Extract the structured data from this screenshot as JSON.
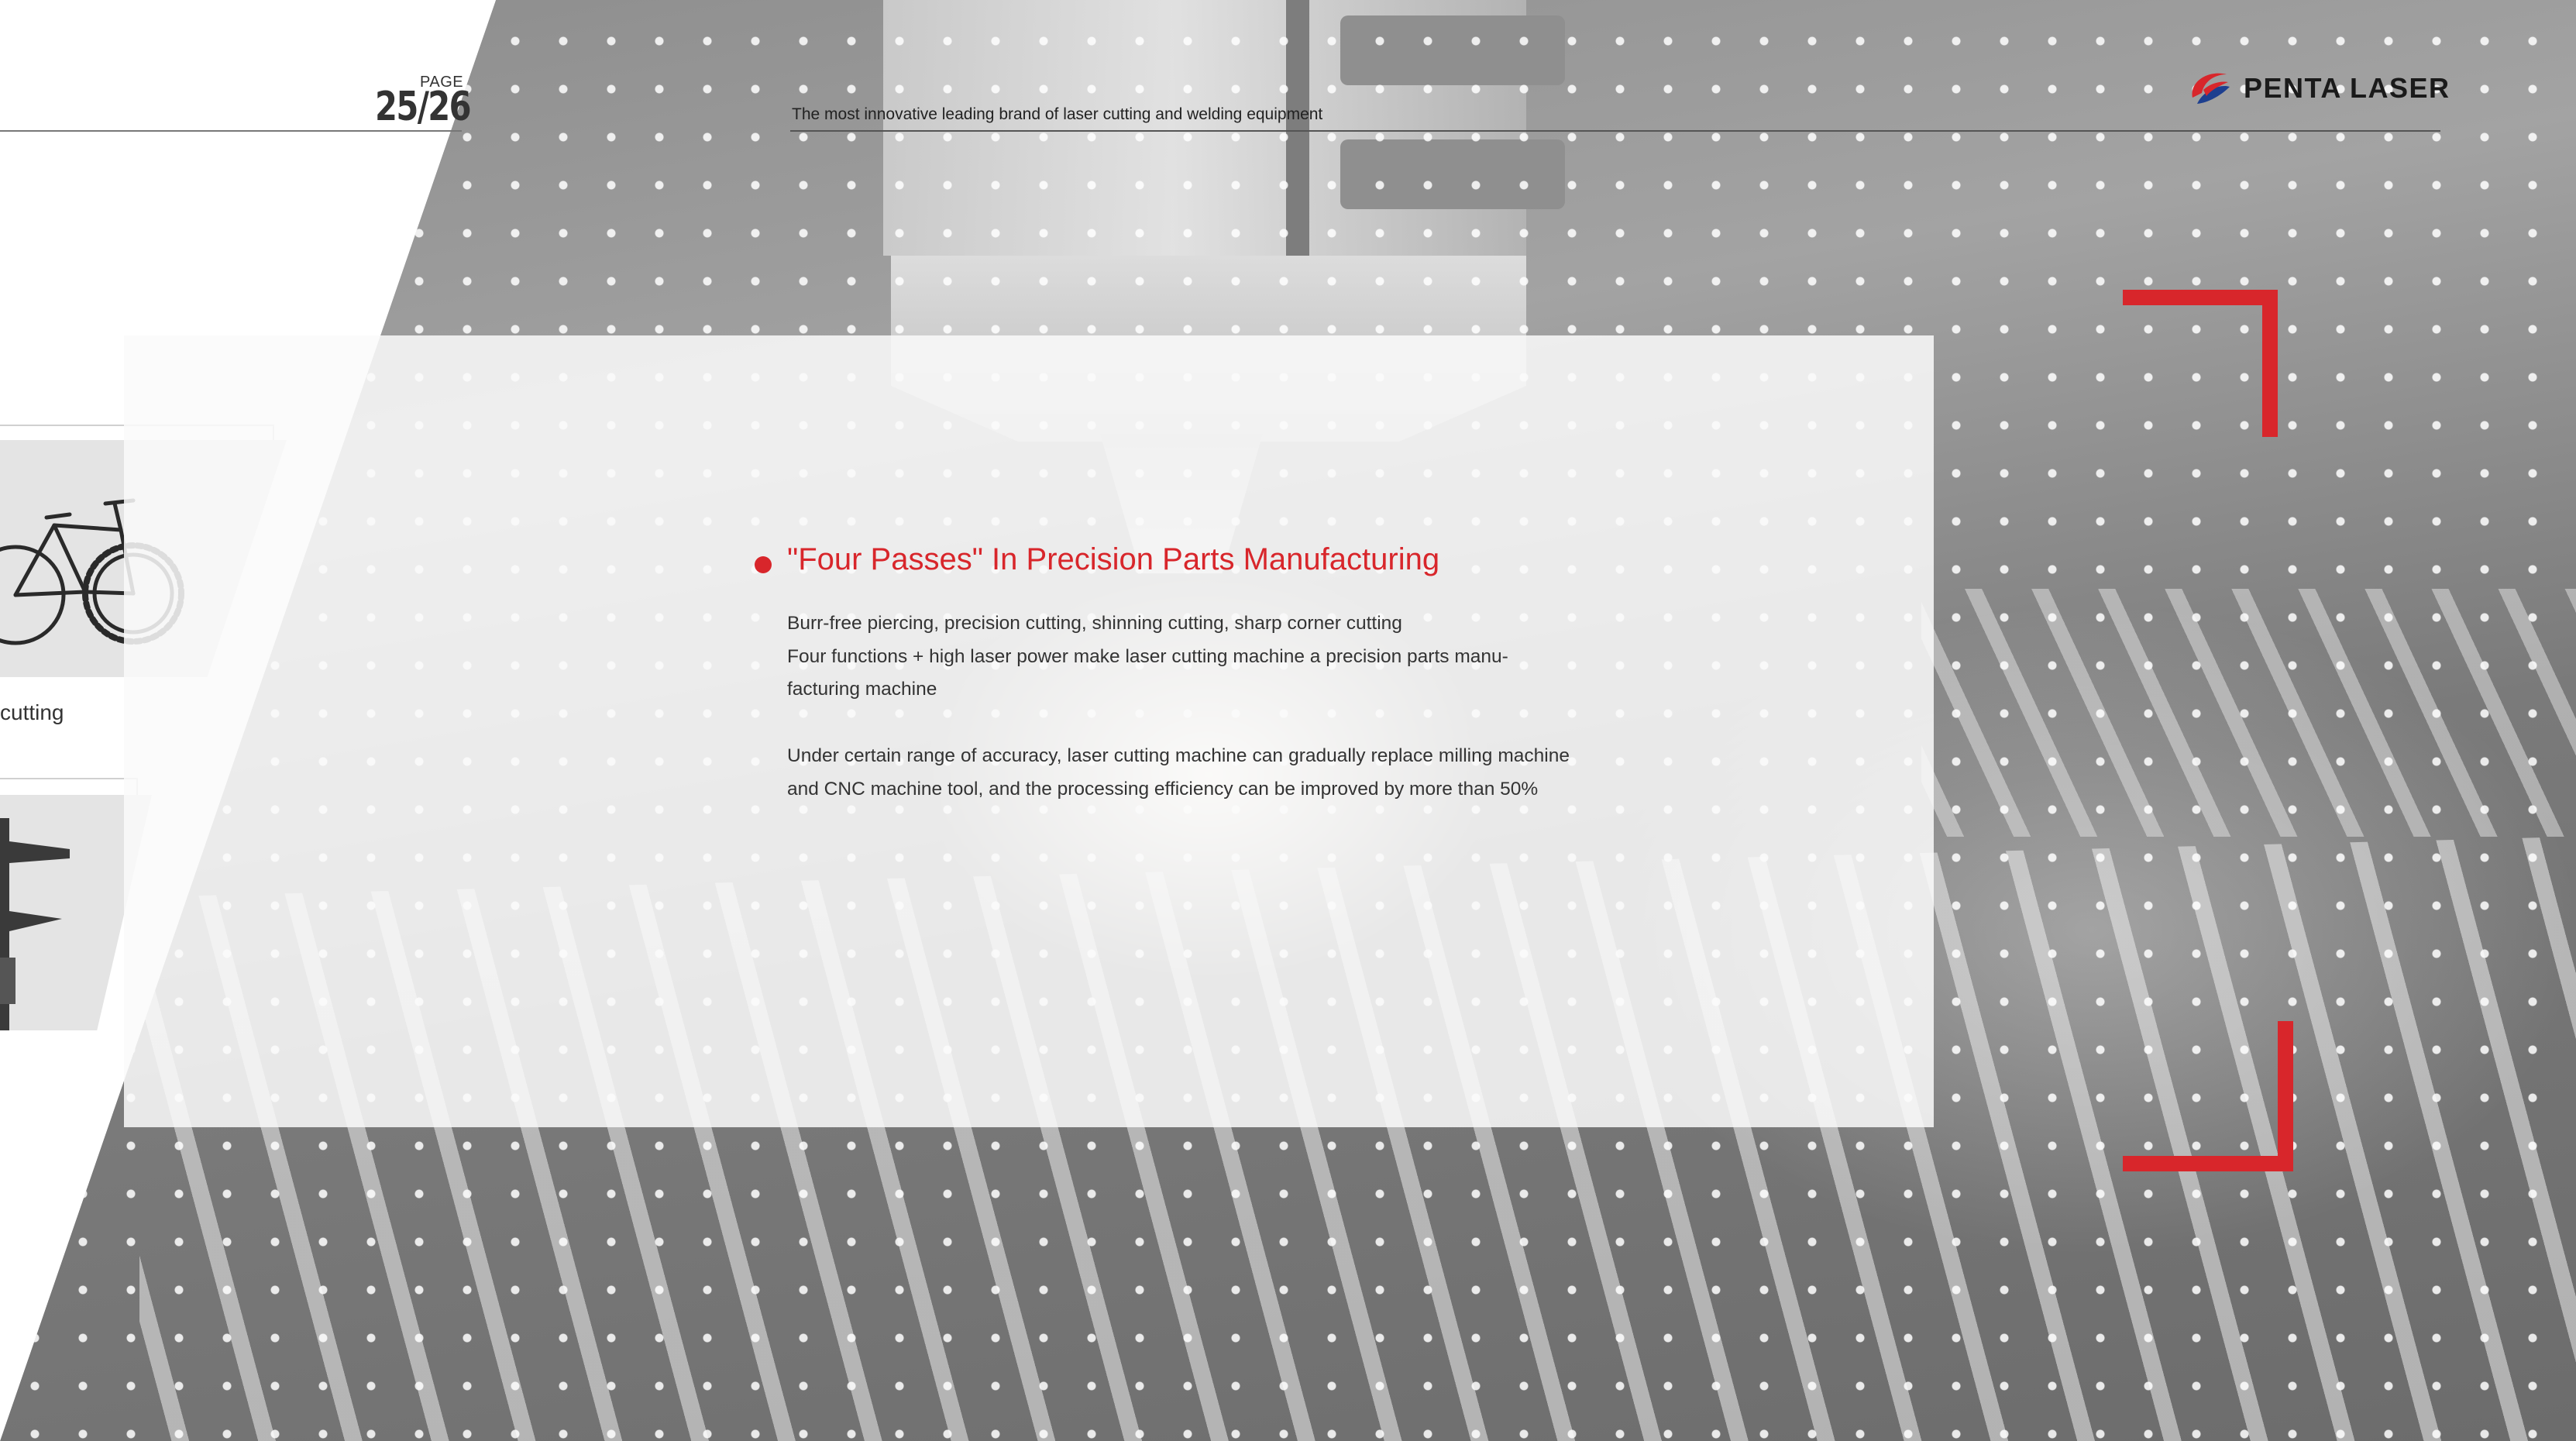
{
  "header": {
    "page_label": "PAGE",
    "page_number": "25/26",
    "tagline": "The most innovative leading brand of laser cutting and welding equipment",
    "brand": "PENTA LASER"
  },
  "sidebar": {
    "caption": "cutting"
  },
  "content": {
    "heading": "\"Four Passes\" In Precision Parts Manufacturing",
    "lines": [
      "Burr-free piercing, precision cutting, shinning cutting, sharp corner cutting",
      "Four functions + high laser power make laser cutting machine a precision parts manu-",
      "facturing machine"
    ],
    "paragraph": "Under certain range of accuracy, laser cutting machine can gradually replace milling machine and CNC machine tool, and the processing efficiency can be improved by more than 50%"
  },
  "colors": {
    "accent": "#d8262b",
    "logo_blue": "#1d3f8f"
  }
}
